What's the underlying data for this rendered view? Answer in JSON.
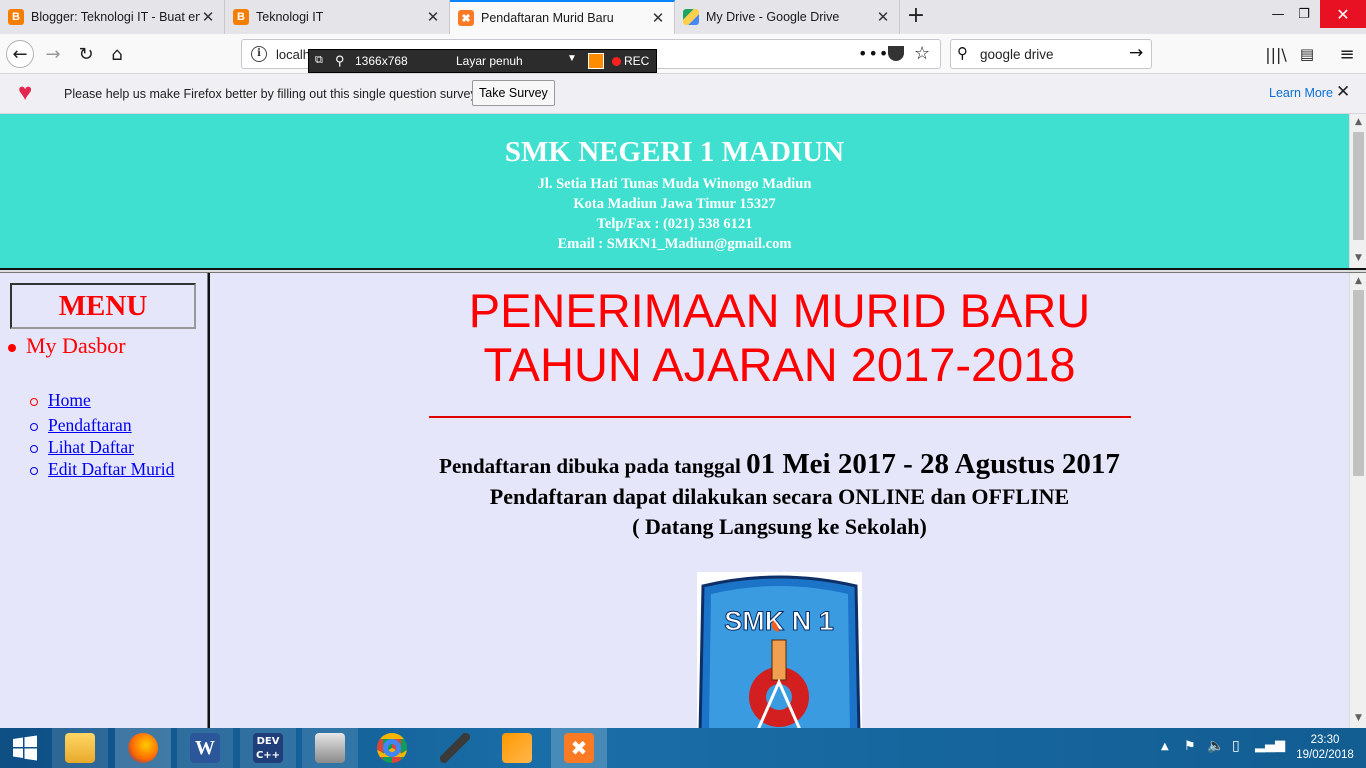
{
  "browser": {
    "tabs": [
      {
        "title": "Blogger: Teknologi IT - Buat en",
        "icon": "blogger-icon",
        "color": "#f57d00"
      },
      {
        "title": "Teknologi IT",
        "icon": "blogger-icon",
        "color": "#f57d00"
      },
      {
        "title": "Pendaftaran Murid Baru",
        "icon": "xampp-icon",
        "color": "#fb7a24"
      },
      {
        "title": "My Drive - Google Drive",
        "icon": "google-drive-icon",
        "color": "#1fa463"
      }
    ],
    "url": "localh",
    "search_value": "google drive"
  },
  "recorder": {
    "resolution": "1366x768",
    "mode": "Layar penuh",
    "rec_label": "REC"
  },
  "notification": {
    "message": "Please help us make Firefox better by filling out this single question survey",
    "button": "Take Survey",
    "learn_more": "Learn More"
  },
  "header": {
    "school": "SMK NEGERI 1 MADIUN",
    "address": [
      "Jl. Setia Hati Tunas Muda Winongo Madiun",
      "Kota Madiun Jawa Timur 15327",
      "Telp/Fax : (021) 538 6121",
      "Email : SMKN1_Madiun@gmail.com"
    ]
  },
  "sidebar": {
    "menu_title": "MENU",
    "dasbor": "My Dasbor",
    "links": [
      "Home",
      "Pendaftaran",
      "Lihat Daftar",
      "Edit Daftar Murid"
    ]
  },
  "main": {
    "headline1": "PENERIMAAN MURID BARU",
    "headline2": "TAHUN AJARAN 2017-2018",
    "open_prefix": "Pendaftaran dibuka pada tanggal ",
    "open_dates": "01 Mei 2017 - 28 Agustus 2017",
    "line2": "Pendaftaran dapat dilakukan secara ONLINE dan OFFLINE",
    "line3": "( Datang Langsung ke Sekolah)",
    "logo_text": "SMK N 1"
  },
  "taskbar": {
    "time": "23:30",
    "date": "19/02/2018"
  },
  "colors": {
    "header_bg": "#40e0d0",
    "page_bg": "#e6e6fa",
    "accent_red": "#ff0000",
    "link": "#0000ee"
  }
}
